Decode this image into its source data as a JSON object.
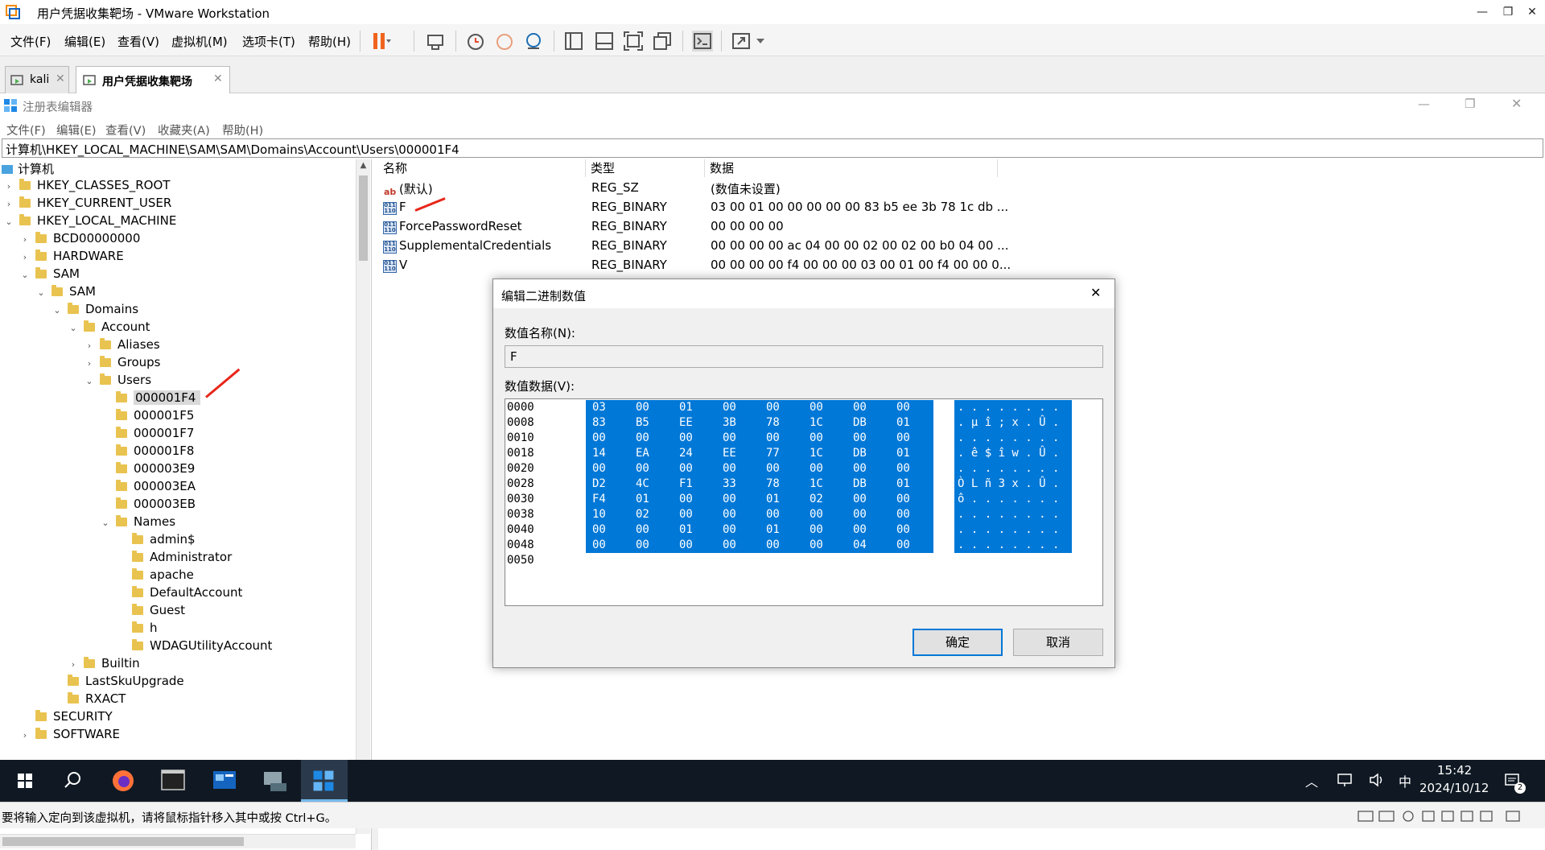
{
  "vm": {
    "title": "用户凭据收集靶场 - VMware Workstation",
    "menu": [
      "文件(F)",
      "编辑(E)",
      "查看(V)",
      "虚拟机(M)",
      "选项卡(T)",
      "帮助(H)"
    ],
    "tabs": [
      {
        "label": "kali"
      },
      {
        "label": "用户凭据收集靶场"
      }
    ],
    "status": "要将输入定向到该虚拟机，请将鼠标指针移入其中或按 Ctrl+G。"
  },
  "regedit": {
    "title": "注册表编辑器",
    "menu": [
      "文件(F)",
      "编辑(E)",
      "查看(V)",
      "收藏夹(A)",
      "帮助(H)"
    ],
    "address": "计算机\\HKEY_LOCAL_MACHINE\\SAM\\SAM\\Domains\\Account\\Users\\000001F4",
    "tree": [
      {
        "label": "计算机",
        "level": 0,
        "chev": ""
      },
      {
        "label": "HKEY_CLASSES_ROOT",
        "level": 1,
        "chev": "›"
      },
      {
        "label": "HKEY_CURRENT_USER",
        "level": 1,
        "chev": "›"
      },
      {
        "label": "HKEY_LOCAL_MACHINE",
        "level": 1,
        "chev": "⌄"
      },
      {
        "label": "BCD00000000",
        "level": 2,
        "chev": "›"
      },
      {
        "label": "HARDWARE",
        "level": 2,
        "chev": "›"
      },
      {
        "label": "SAM",
        "level": 2,
        "chev": "⌄"
      },
      {
        "label": "SAM",
        "level": 3,
        "chev": "⌄"
      },
      {
        "label": "Domains",
        "level": 4,
        "chev": "⌄"
      },
      {
        "label": "Account",
        "level": 5,
        "chev": "⌄"
      },
      {
        "label": "Aliases",
        "level": 6,
        "chev": "›"
      },
      {
        "label": "Groups",
        "level": 6,
        "chev": "›"
      },
      {
        "label": "Users",
        "level": 6,
        "chev": "⌄"
      },
      {
        "label": "000001F4",
        "level": 7,
        "chev": "",
        "selected": true
      },
      {
        "label": "000001F5",
        "level": 7,
        "chev": ""
      },
      {
        "label": "000001F7",
        "level": 7,
        "chev": ""
      },
      {
        "label": "000001F8",
        "level": 7,
        "chev": ""
      },
      {
        "label": "000003E9",
        "level": 7,
        "chev": ""
      },
      {
        "label": "000003EA",
        "level": 7,
        "chev": ""
      },
      {
        "label": "000003EB",
        "level": 7,
        "chev": ""
      },
      {
        "label": "Names",
        "level": 7,
        "chev": "⌄"
      },
      {
        "label": "admin$",
        "level": 8,
        "chev": ""
      },
      {
        "label": "Administrator",
        "level": 8,
        "chev": ""
      },
      {
        "label": "apache",
        "level": 8,
        "chev": ""
      },
      {
        "label": "DefaultAccount",
        "level": 8,
        "chev": ""
      },
      {
        "label": "Guest",
        "level": 8,
        "chev": ""
      },
      {
        "label": "h",
        "level": 8,
        "chev": ""
      },
      {
        "label": "WDAGUtilityAccount",
        "level": 8,
        "chev": ""
      },
      {
        "label": "Builtin",
        "level": 5,
        "chev": "›"
      },
      {
        "label": "LastSkuUpgrade",
        "level": 4,
        "chev": ""
      },
      {
        "label": "RXACT",
        "level": 4,
        "chev": ""
      },
      {
        "label": "SECURITY",
        "level": 2,
        "chev": ""
      },
      {
        "label": "SOFTWARE",
        "level": 2,
        "chev": "›"
      }
    ],
    "columns": [
      "名称",
      "类型",
      "数据"
    ],
    "values": [
      {
        "name": "(默认)",
        "type": "REG_SZ",
        "data": "(数值未设置)",
        "icon": "ab"
      },
      {
        "name": "F",
        "type": "REG_BINARY",
        "data": "03 00 01 00 00 00 00 00 83 b5 ee 3b 78 1c db ...",
        "icon": "bin"
      },
      {
        "name": "ForcePasswordReset",
        "type": "REG_BINARY",
        "data": "00 00 00 00",
        "icon": "bin"
      },
      {
        "name": "SupplementalCredentials",
        "type": "REG_BINARY",
        "data": "00 00 00 00 ac 04 00 00 02 00 02 00 b0 04 00 ...",
        "icon": "bin"
      },
      {
        "name": "V",
        "type": "REG_BINARY",
        "data": "00 00 00 00 f4 00 00 00 03 00 01 00 f4 00 00 0...",
        "icon": "bin"
      }
    ]
  },
  "dialog": {
    "title": "编辑二进制数值",
    "name_label": "数值名称(N):",
    "name_value": "F",
    "data_label": "数值数据(V):",
    "hex_rows": [
      {
        "offset": "0000",
        "bytes": [
          "03",
          "00",
          "01",
          "00",
          "00",
          "00",
          "00",
          "00"
        ],
        "ascii": ". . . . . . . ."
      },
      {
        "offset": "0008",
        "bytes": [
          "83",
          "B5",
          "EE",
          "3B",
          "78",
          "1C",
          "DB",
          "01"
        ],
        "ascii": ". µ î ; x . Û ."
      },
      {
        "offset": "0010",
        "bytes": [
          "00",
          "00",
          "00",
          "00",
          "00",
          "00",
          "00",
          "00"
        ],
        "ascii": ". . . . . . . ."
      },
      {
        "offset": "0018",
        "bytes": [
          "14",
          "EA",
          "24",
          "EE",
          "77",
          "1C",
          "DB",
          "01"
        ],
        "ascii": ". ê $ î w . Û ."
      },
      {
        "offset": "0020",
        "bytes": [
          "00",
          "00",
          "00",
          "00",
          "00",
          "00",
          "00",
          "00"
        ],
        "ascii": ". . . . . . . ."
      },
      {
        "offset": "0028",
        "bytes": [
          "D2",
          "4C",
          "F1",
          "33",
          "78",
          "1C",
          "DB",
          "01"
        ],
        "ascii": "Ò L ñ 3 x . Û ."
      },
      {
        "offset": "0030",
        "bytes": [
          "F4",
          "01",
          "00",
          "00",
          "01",
          "02",
          "00",
          "00"
        ],
        "ascii": "ô . . . . . . ."
      },
      {
        "offset": "0038",
        "bytes": [
          "10",
          "02",
          "00",
          "00",
          "00",
          "00",
          "00",
          "00"
        ],
        "ascii": ". . . . . . . ."
      },
      {
        "offset": "0040",
        "bytes": [
          "00",
          "00",
          "01",
          "00",
          "01",
          "00",
          "00",
          "00"
        ],
        "ascii": ". . . . . . . ."
      },
      {
        "offset": "0048",
        "bytes": [
          "00",
          "00",
          "00",
          "00",
          "00",
          "00",
          "04",
          "00"
        ],
        "ascii": ". . . . . . . ."
      },
      {
        "offset": "0050",
        "bytes": [],
        "ascii": ""
      }
    ],
    "ok_label": "确定",
    "cancel_label": "取消"
  },
  "taskbar": {
    "time": "15:42",
    "date": "2024/10/12",
    "ime": "中",
    "notification_count": "2"
  }
}
